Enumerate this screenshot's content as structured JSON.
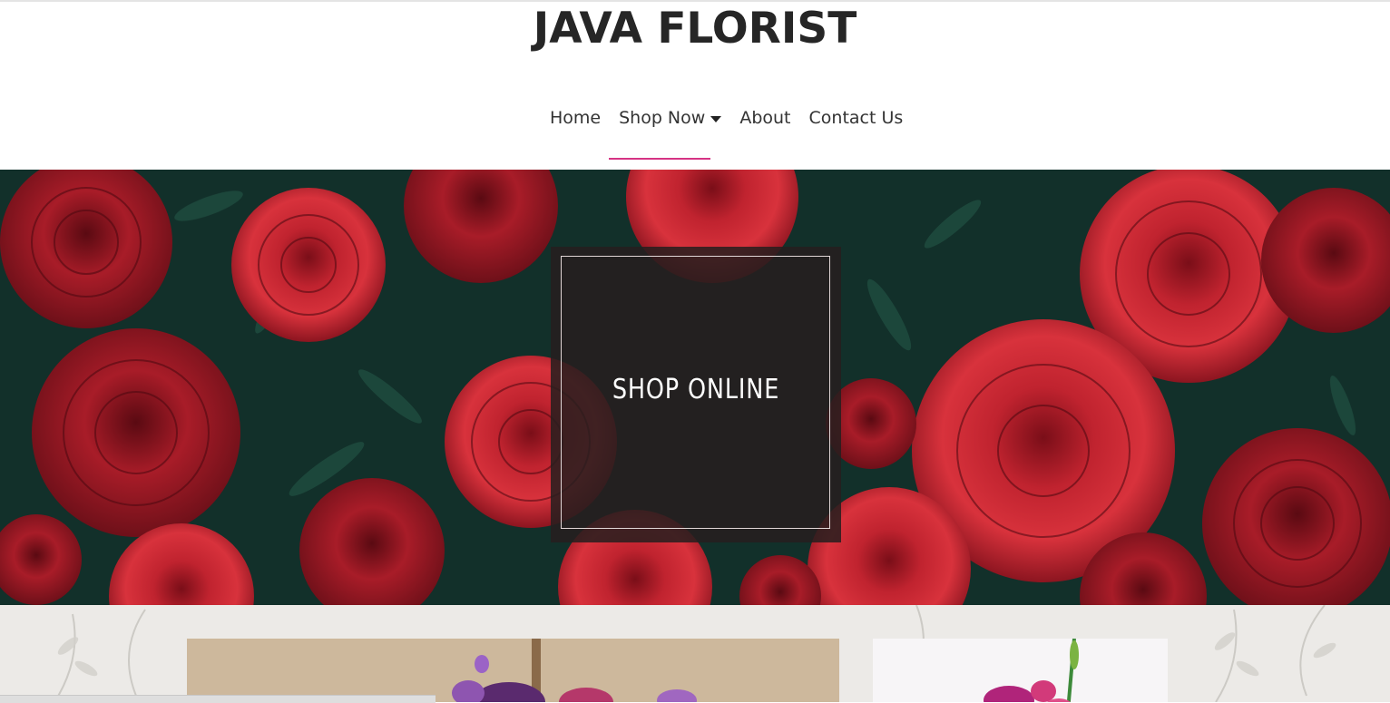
{
  "header": {
    "brand": "JAVA FLORIST"
  },
  "nav": {
    "items": [
      {
        "label": "Home"
      },
      {
        "label": "Shop Now",
        "dropdown": true
      },
      {
        "label": "About"
      },
      {
        "label": "Contact Us"
      }
    ],
    "active_index": 1,
    "accent_color": "#d63384"
  },
  "hero": {
    "cta_label": "SHOP ONLINE",
    "image": "red-roses"
  },
  "products": {
    "images": [
      "purple-flower-arrangement",
      "pink-flower-bouquet"
    ]
  }
}
